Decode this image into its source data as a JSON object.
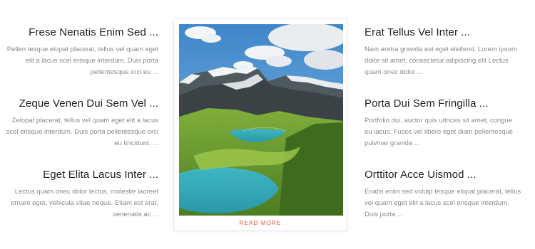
{
  "left_items": [
    {
      "title": "Frese Nenatis Enim Sed ...",
      "text": "Pellen tesque elopat placerat, tellus vel quam eget elit a lacus scel erisque interdum. Duis porta pellentesque orci eu ..."
    },
    {
      "title": "Zeque Venen Dui Sem Vel ...",
      "text": "Zelopat placerat, tellus vel quam eget elit a lacus scel erisque interdum. Duis porta pellentesque orci eu tincidunt. ..."
    },
    {
      "title": "Eget Elita Lacus Inter ...",
      "text": "Lectus quam onec dolor lectus, molestie laoreet ornare eget, vehicula vitae neque. Etiam est erat, venenatis ac ..."
    }
  ],
  "right_items": [
    {
      "title": "Erat Tellus Vel Inter ...",
      "text": "Nam aretra gravida est eget eleifend. Lorem ipsum dolor sit amet, consectetur adipiscing elit Lectus quam onec dolor ..."
    },
    {
      "title": "Porta Dui Sem Fringilla ...",
      "text": "Portfolio dui, auctor quis ultrices sit amet, congue eu lacus. Fusce vel libero eget diam pellentesque pulvinar gravida ..."
    },
    {
      "title": "Orttitor Acce Uismod ...",
      "text": "Enatis enim sed volutp tesque elopat placerat, tellus vel quam eget elit a lacus scel erisque interdum. Duis porta ..."
    }
  ],
  "card": {
    "read_more_label": "READ MORE"
  },
  "colors": {
    "accent": "#d9532c",
    "title": "#222222",
    "text": "#8a8a8a"
  }
}
